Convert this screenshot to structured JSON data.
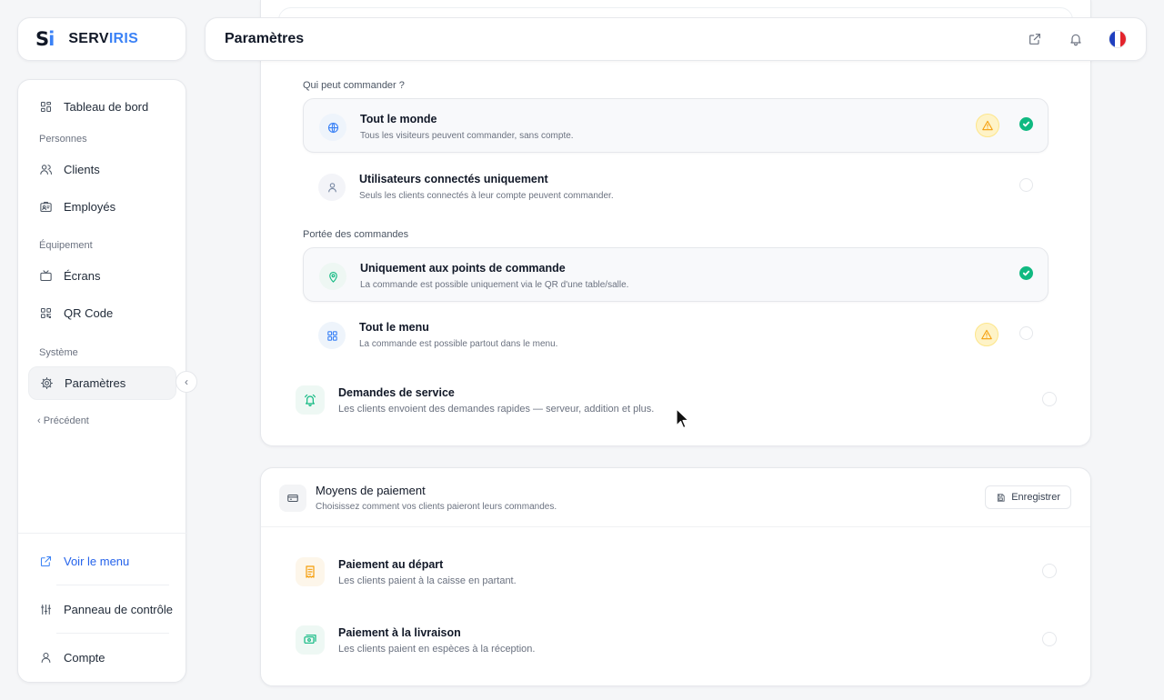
{
  "brand": {
    "mark_s": "S",
    "mark_i": "i",
    "name_part1": "SERV",
    "name_part2": "IRIS",
    "accent_color": "#3b82f6"
  },
  "header": {
    "title": "Paramètres",
    "icons": [
      "external-link-icon",
      "bell-icon",
      "flag-fr-icon"
    ]
  },
  "sidebar": {
    "dashboard": "Tableau de bord",
    "section_people": "Personnes",
    "clients": "Clients",
    "employees": "Employés",
    "section_equipment": "Équipement",
    "screens": "Écrans",
    "qrcode": "QR Code",
    "section_system": "Système",
    "settings": "Paramètres",
    "previous": "‹  Précédent",
    "view_menu": "Voir le menu",
    "control_panel": "Panneau de contrôle",
    "account": "Compte"
  },
  "ordering": {
    "who_label": "Qui peut commander ?",
    "options_who": [
      {
        "title": "Tout le monde",
        "desc": "Tous les visiteurs peuvent commander, sans compte.",
        "selected": true,
        "warning": true
      },
      {
        "title": "Utilisateurs connectés uniquement",
        "desc": "Seuls les clients connectés à leur compte peuvent commander.",
        "selected": false,
        "warning": false
      }
    ],
    "scope_label": "Portée des commandes",
    "options_scope": [
      {
        "title": "Uniquement aux points de commande",
        "desc": "La commande est possible uniquement via le QR d'une table/salle.",
        "selected": true,
        "warning": false
      },
      {
        "title": "Tout le menu",
        "desc": "La commande est possible partout dans le menu.",
        "selected": false,
        "warning": true
      }
    ]
  },
  "service_requests": {
    "title": "Demandes de service",
    "desc": "Les clients envoient des demandes rapides — serveur, addition et plus.",
    "enabled": false
  },
  "payment": {
    "title": "Moyens de paiement",
    "subtitle": "Choisissez comment vos clients paieront leurs commandes.",
    "save_label": "Enregistrer",
    "methods": [
      {
        "title": "Paiement au départ",
        "desc": "Les clients paient à la caisse en partant.",
        "enabled": false,
        "color": "#f59e0b"
      },
      {
        "title": "Paiement à la livraison",
        "desc": "Les clients paient en espèces à la réception.",
        "enabled": false,
        "color": "#10b981"
      }
    ]
  },
  "colors": {
    "success": "#10b981",
    "warning": "#f59e0b",
    "link": "#2563eb"
  }
}
